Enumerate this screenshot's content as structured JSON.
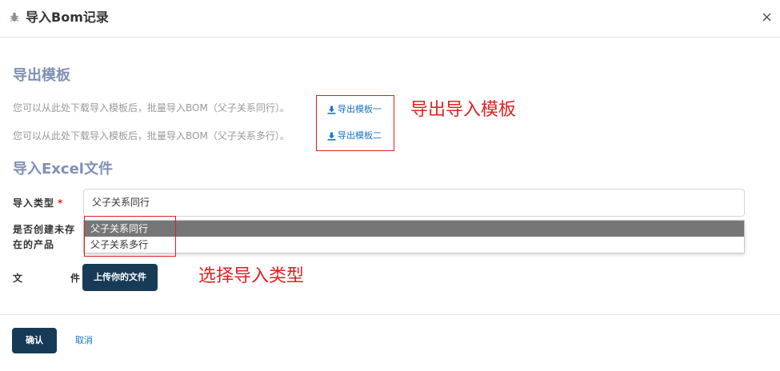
{
  "dialog": {
    "title": "导入Bom记录",
    "close_glyph": "×",
    "icons": {
      "title": "bug-icon",
      "close": "close-icon"
    }
  },
  "export_section": {
    "title": "导出模板",
    "rows": [
      {
        "description": "您可以从此处下载导入模板后，批量导入BOM（父子关系同行）。",
        "link_label": "导出模板一"
      },
      {
        "description": "您可以从此处下载导入模板后，批量导入BOM（父子关系多行）。",
        "link_label": "导出模板二"
      }
    ],
    "link_icon": "download-icon"
  },
  "import_section": {
    "title": "导入Excel文件",
    "fields": {
      "import_type": {
        "label": "导入类型",
        "required_mark": "*",
        "value": "父子关系同行",
        "options": [
          "父子关系同行",
          "父子关系多行"
        ],
        "highlighted_option": "父子关系同行"
      },
      "create_missing_product": {
        "label": "是否创建未存在的产品"
      },
      "file": {
        "label_chars": [
          "文",
          "件"
        ],
        "upload_label": "上传你的文件"
      }
    }
  },
  "annotations": [
    {
      "text": "导出导入模板"
    },
    {
      "text": "选择导入类型"
    }
  ],
  "footer": {
    "confirm_label": "确认",
    "cancel_label": "取消"
  },
  "colors": {
    "section_title": "#8090b4",
    "primary_button": "#173a57",
    "link": "#1a73c8",
    "annotation": "#e02020",
    "selected_option_bg": "#767676"
  }
}
